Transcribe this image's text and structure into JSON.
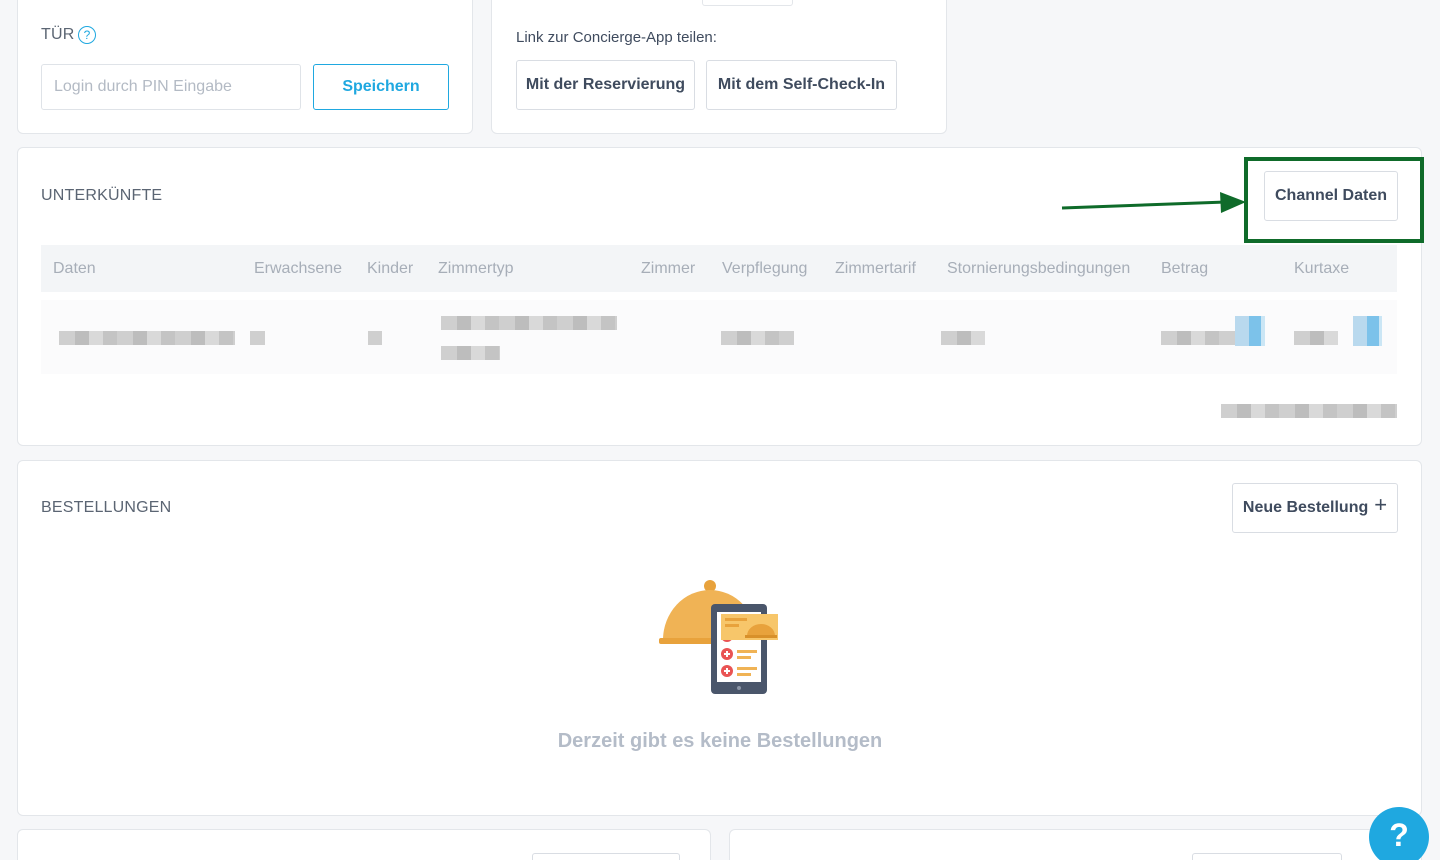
{
  "door": {
    "title": "TÜR",
    "help": "?",
    "pin_placeholder": "Login durch PIN Eingabe",
    "save_label": "Speichern"
  },
  "concierge": {
    "share_label": "Link zur Concierge-App teilen:",
    "btn_reservation": "Mit der Reservierung",
    "btn_selfcheckin": "Mit dem Self-Check-In"
  },
  "accommodations": {
    "title": "UNTERKÜNFTE",
    "channel_btn": "Channel Daten",
    "columns": [
      "Daten",
      "Erwachsene",
      "Kinder",
      "Zimmertyp",
      "Zimmer",
      "Verpflegung",
      "Zimmertarif",
      "Stornierungsbedingungen",
      "Betrag",
      "Kurtaxe"
    ]
  },
  "orders": {
    "title": "BESTELLUNGEN",
    "new_btn": "Neue Bestellung",
    "new_btn_icon": "+",
    "empty_text": "Derzeit gibt es keine Bestellungen"
  },
  "help_fab": "?",
  "colors": {
    "accent": "#1fa8e0",
    "highlight": "#0f6b2a",
    "bg": "#f6f7f9"
  }
}
